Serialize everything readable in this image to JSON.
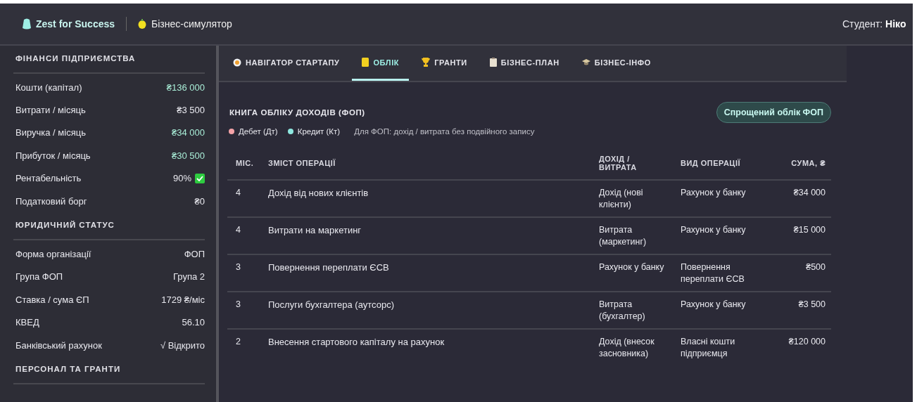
{
  "header": {
    "brand": "Zest for Success",
    "app": "Бізнес-симулятор",
    "student": "Студент: **Ніко**"
  },
  "sidebar": {
    "sections": [
      {
        "title": "ФІНАНСИ ПІДПРИЄМСТВА",
        "rows": [
          {
            "label": "Кошти (капітал)",
            "value": "₴136 000",
            "highlight": true,
            "checked": false
          },
          {
            "label": "Витрати / місяць",
            "value": "₴3 500",
            "highlight": false,
            "checked": false
          },
          {
            "label": "Виручка / місяць",
            "value": "₴34 000",
            "highlight": true,
            "checked": false
          },
          {
            "label": "Прибуток / місяць",
            "value": "₴30 500",
            "highlight": true,
            "checked": false
          },
          {
            "label": "Рентабельність",
            "value": "90%",
            "highlight": false,
            "checked": true
          },
          {
            "label": "Податковий борг",
            "value": "₴0",
            "highlight": false,
            "checked": false
          }
        ]
      },
      {
        "title": "ЮРИДИЧНИЙ СТАТУС",
        "rows": [
          {
            "label": "Форма організації",
            "value": "ФОП",
            "highlight": false,
            "checked": false
          },
          {
            "label": "Група ФОП",
            "value": "Група 2",
            "highlight": false,
            "checked": false
          },
          {
            "label": "Ставка / сума ЄП",
            "value": "1729 ₴/міс",
            "highlight": false,
            "checked": false
          },
          {
            "label": "КВЕД",
            "value": "56.10",
            "highlight": false,
            "checked": false
          },
          {
            "label": "Банківський рахунок",
            "value": "√ Відкрито",
            "highlight": false,
            "checked": false
          }
        ]
      },
      {
        "title": "ПЕРСОНАЛ ТА ГРАНТИ"
      }
    ]
  },
  "tabs": [
    {
      "label": "НАВІГАТОР СТАРТАПУ",
      "selected": false
    },
    {
      "label": "ОБЛІК",
      "selected": true
    },
    {
      "label": "ГРАНТИ",
      "selected": false
    },
    {
      "label": "БІЗНЕС-ПЛАН",
      "selected": false
    },
    {
      "label": "БІЗНЕС-ІНФО",
      "selected": false
    }
  ],
  "ledger": {
    "title": "КНИГА ОБЛІКУ ДОХОДІВ (ФОП)",
    "button": "Спрощений облік ФОП",
    "legend": [
      {
        "label": "Дебет (Дт)",
        "color": "#f4a3a8"
      },
      {
        "label": "Кредит (Кт)",
        "color": "#8ee8e0"
      }
    ],
    "note": "Для ФОП: дохід / витрата без подвійного запису",
    "columns": [
      "МІС.",
      "ЗМІСТ ОПЕРАЦІЇ",
      "ДОХІД / ВИТРАТА",
      "ВИД ОПЕРАЦІЇ",
      "СУМА, ₴"
    ],
    "rows": [
      [
        "4",
        "Дохід від нових клієнтів",
        "Дохід (нові клієнти)",
        "Рахунок у банку",
        "₴34 000"
      ],
      [
        "4",
        "Витрати на маркетинг",
        "Витрата (маркетинг)",
        "Рахунок у банку",
        "₴15 000"
      ],
      [
        "3",
        "Повернення переплати ЄСВ",
        "Рахунок у банку",
        "Повернення переплати ЄСВ",
        "₴500"
      ],
      [
        "3",
        "Послуги бухгалтера (аутсорс)",
        "Витрата (бухгалтер)",
        "Рахунок у банку",
        "₴3 500"
      ],
      [
        "2",
        "Внесення стартового капіталу на рахунок",
        "Дохід (внесок засновника)",
        "Власні кошти підприємця",
        "₴120 000"
      ]
    ]
  }
}
